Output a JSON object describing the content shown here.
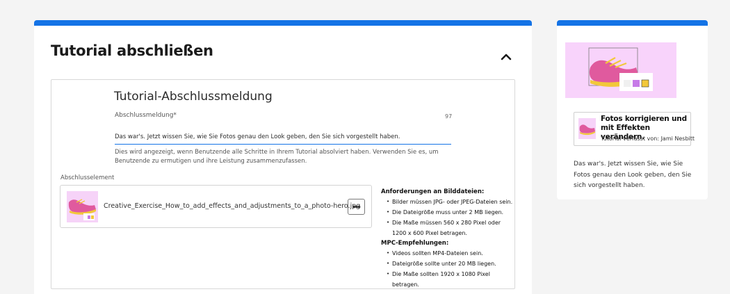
{
  "section": {
    "title": "Tutorial abschließen"
  },
  "completion": {
    "heading": "Tutorial-Abschlussmeldung",
    "field_label": "Abschlussmeldung*",
    "char_count": "97",
    "message_value": "Das war's. Jetzt wissen Sie, wie Sie Fotos genau den Look geben, den Sie sich vorgestellt haben.",
    "help_text": "Dies wird angezeigt, wenn Benutzende alle Schritte in Ihrem Tutorial absolviert haben. Verwenden Sie es, um Benutzende zu ermutigen und ihre Leistung zusammenzufassen."
  },
  "element": {
    "label": "Abschlusselement",
    "file_name": "Creative_Exercise_How_to_add_effects_and_adjustments_to_a_photo-hero.jpg",
    "more_label": "•••"
  },
  "requirements": {
    "image_heading": "Anforderungen an Bilddateien:",
    "image_items": [
      "Bilder müssen JPG- oder JPEG-Dateien sein.",
      "Die Dateigröße muss unter 2 MB liegen.",
      "Die Maße müssen 560 x 280 Pixel oder",
      "1200 x 600 Pixel betragen."
    ],
    "mpc_heading": "MPC-Empfehlungen:",
    "mpc_items": [
      "Videos sollten MP4-Dateien sein.",
      "Dateigröße sollte unter 20 MB liegen.",
      "Die Maße sollten 1920 x 1080 Pixel betragen."
    ]
  },
  "preview": {
    "card_title": "Fotos korrigieren und mit Effekten verändern.",
    "card_author": "Tutorial verfasst von: Jami Nesbitt",
    "description": "Das war's. Jetzt wissen Sie, wie Sie Fotos genau den Look geben, den Sie sich vorgestellt haben."
  },
  "colors": {
    "accent": "#1473e6",
    "thumb_bg": "#f8d3fb",
    "shoe_pink": "#e05a9e",
    "shoe_yellow": "#f2c83a"
  },
  "icons": {
    "collapse": "chevron-up-icon",
    "more": "more-icon"
  }
}
